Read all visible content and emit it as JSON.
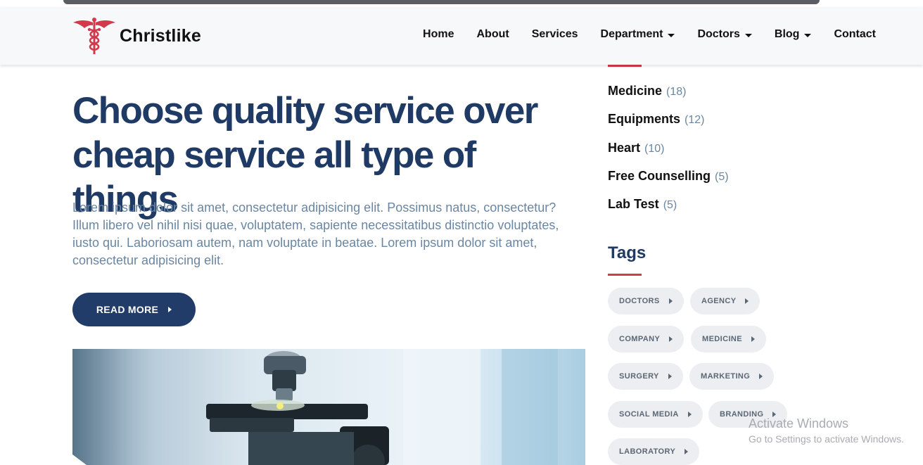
{
  "brand": {
    "name": "Christlike",
    "logo_icon": "caduceus-icon",
    "accent_color": "#d23a4c"
  },
  "nav": {
    "items": [
      {
        "label": "Home",
        "dropdown": false
      },
      {
        "label": "About",
        "dropdown": false
      },
      {
        "label": "Services",
        "dropdown": false
      },
      {
        "label": "Department",
        "dropdown": true
      },
      {
        "label": "Doctors",
        "dropdown": true
      },
      {
        "label": "Blog",
        "dropdown": true
      },
      {
        "label": "Contact",
        "dropdown": false
      }
    ]
  },
  "post": {
    "title": "Choose quality service over cheap service all type of things",
    "body": "Lorem ipsum dolor sit amet, consectetur adipisicing elit. Possimus natus, consectetur? Illum libero vel nihil nisi quae, voluptatem, sapiente necessitatibus distinctio voluptates, iusto qui. Laboriosam autem, nam voluptate in beatae. Lorem ipsum dolor sit amet, consectetur adipisicing elit.",
    "read_more_label": "READ MORE",
    "title_color": "#1f3a64",
    "button_color": "#213c68"
  },
  "sidebar": {
    "categories": [
      {
        "name": "Medicine",
        "count": "(18)"
      },
      {
        "name": "Equipments",
        "count": "(12)"
      },
      {
        "name": "Heart",
        "count": "(10)"
      },
      {
        "name": "Free Counselling",
        "count": "(5)"
      },
      {
        "name": "Lab Test",
        "count": "(5)"
      }
    ],
    "tags_title": "Tags",
    "tags": [
      "DOCTORS",
      "AGENCY",
      "COMPANY",
      "MEDICINE",
      "SURGERY",
      "MARKETING",
      "SOCIAL MEDIA",
      "BRANDING",
      "LABORATORY"
    ]
  },
  "watermark": {
    "line1": "Activate Windows",
    "line2": "Go to Settings to activate Windows."
  }
}
